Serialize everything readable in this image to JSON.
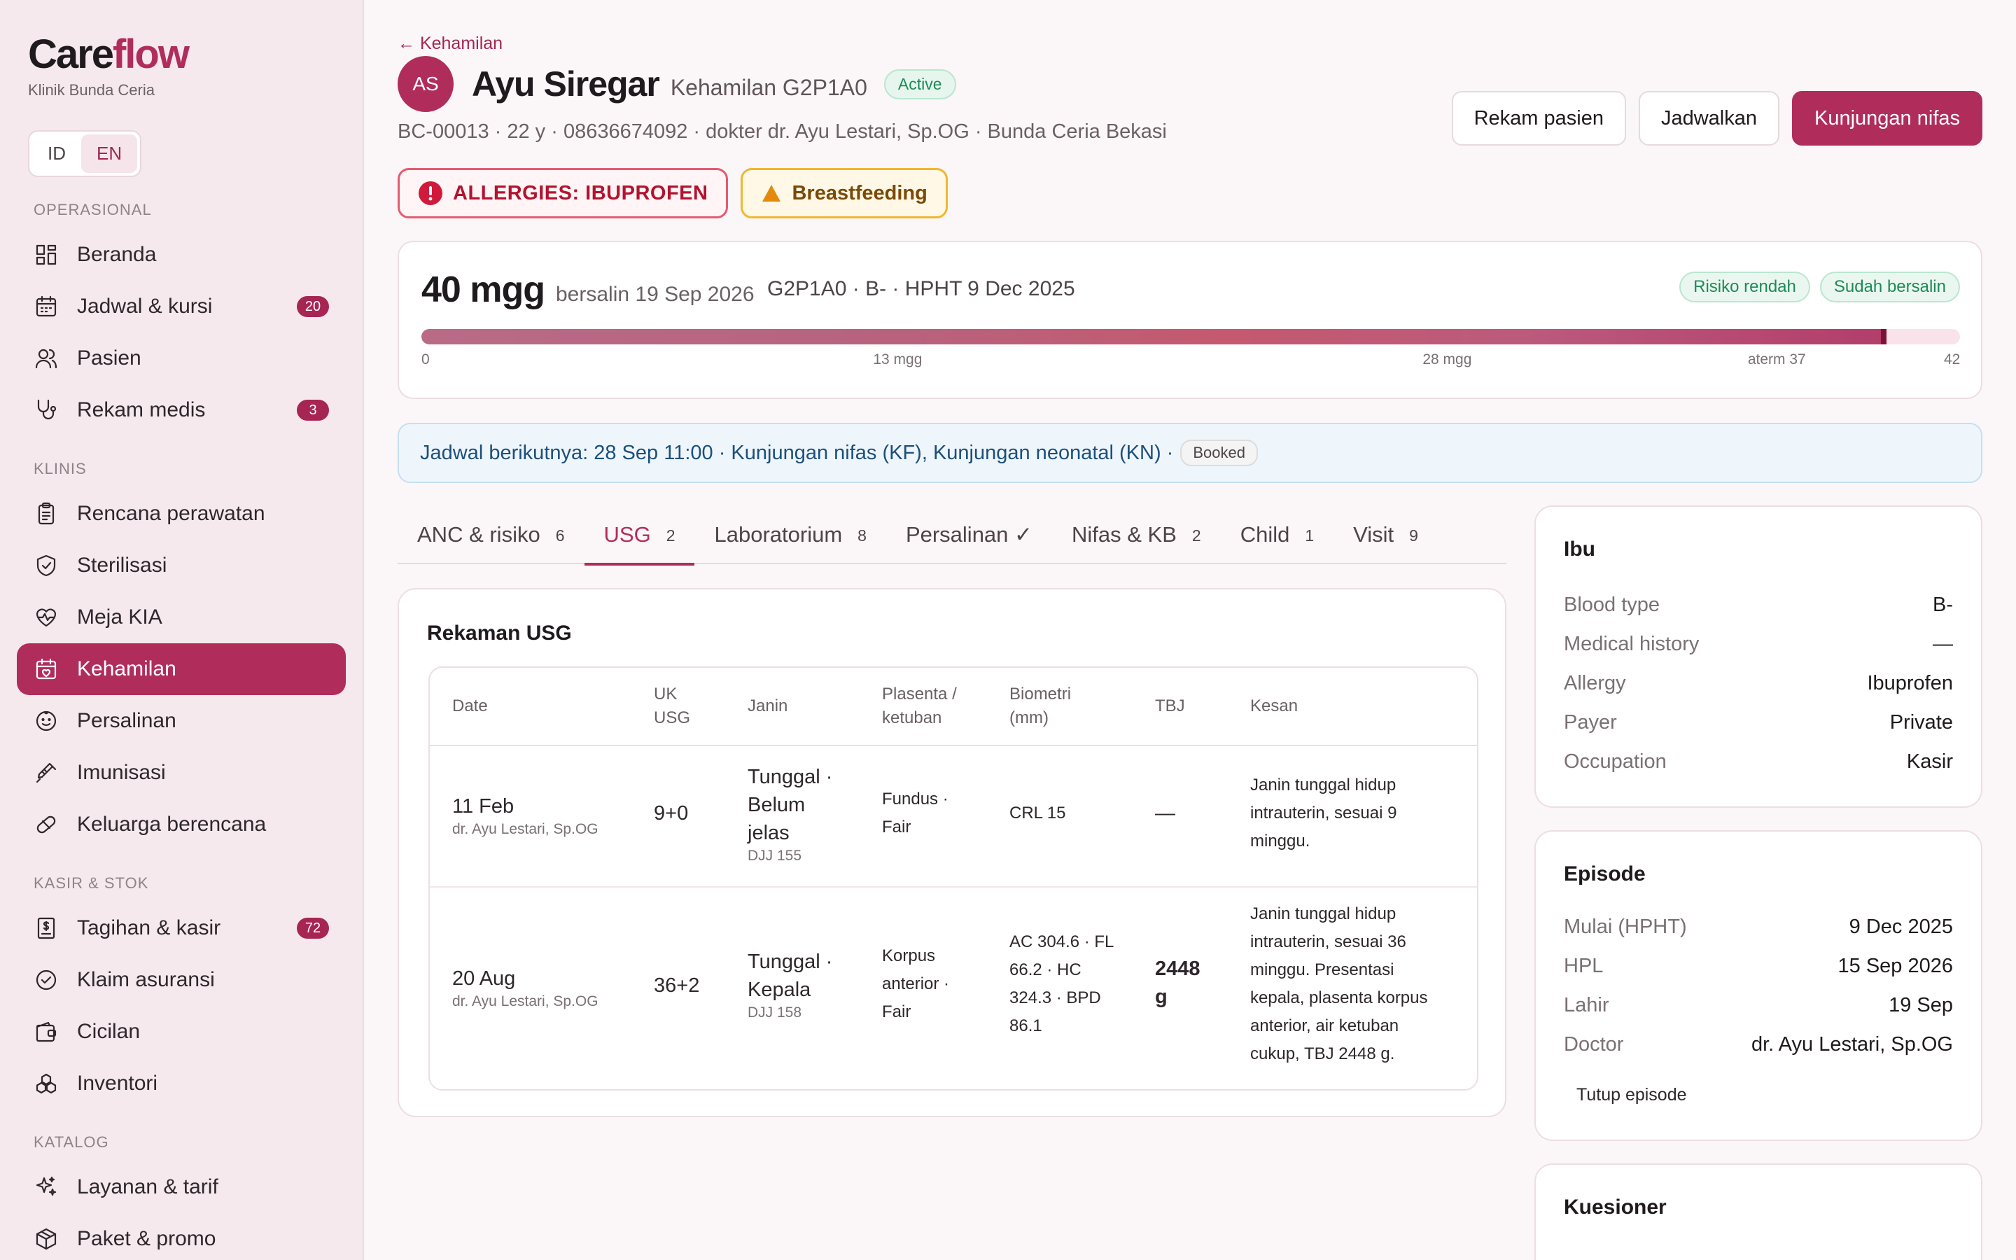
{
  "brand": {
    "part1": "Care",
    "part2": "flow",
    "clinic": "Klinik Bunda Ceria"
  },
  "lang": {
    "id": "ID",
    "en": "EN"
  },
  "sidebar": {
    "sections": [
      {
        "title": "OPERASIONAL",
        "items": [
          {
            "label": "Beranda",
            "icon": "grid-icon",
            "badge": ""
          },
          {
            "label": "Jadwal & kursi",
            "icon": "calendar-icon",
            "badge": "20"
          },
          {
            "label": "Pasien",
            "icon": "users-icon",
            "badge": ""
          },
          {
            "label": "Rekam medis",
            "icon": "stethoscope-icon",
            "badge": "3"
          }
        ]
      },
      {
        "title": "KLINIS",
        "items": [
          {
            "label": "Rencana perawatan",
            "icon": "clipboard-icon",
            "badge": ""
          },
          {
            "label": "Sterilisasi",
            "icon": "shield-icon",
            "badge": ""
          },
          {
            "label": "Meja KIA",
            "icon": "heart-pulse-icon",
            "badge": ""
          },
          {
            "label": "Kehamilan",
            "icon": "calendar-heart-icon",
            "badge": "",
            "active": true
          },
          {
            "label": "Persalinan",
            "icon": "baby-icon",
            "badge": ""
          },
          {
            "label": "Imunisasi",
            "icon": "syringe-icon",
            "badge": ""
          },
          {
            "label": "Keluarga berencana",
            "icon": "pill-icon",
            "badge": ""
          }
        ]
      },
      {
        "title": "KASIR & STOK",
        "items": [
          {
            "label": "Tagihan & kasir",
            "icon": "receipt-icon",
            "badge": "72"
          },
          {
            "label": "Klaim asuransi",
            "icon": "check-circle-icon",
            "badge": ""
          },
          {
            "label": "Cicilan",
            "icon": "wallet-icon",
            "badge": ""
          },
          {
            "label": "Inventori",
            "icon": "boxes-icon",
            "badge": ""
          }
        ]
      },
      {
        "title": "KATALOG",
        "items": [
          {
            "label": "Layanan & tarif",
            "icon": "sparkles-icon",
            "badge": ""
          },
          {
            "label": "Paket & promo",
            "icon": "package-icon",
            "badge": ""
          }
        ]
      }
    ]
  },
  "patient": {
    "back": "← Kehamilan",
    "initials": "AS",
    "name": "Ayu Siregar",
    "pregnancy": "Kehamilan G2P1A0",
    "status": "Active",
    "meta": "BC-00013 · 22 y · 08636674092 · dokter dr. Ayu Lestari, Sp.OG · Bunda Ceria Bekasi"
  },
  "actions": {
    "record": "Rekam pasien",
    "schedule": "Jadwalkan",
    "postnatal": "Kunjungan nifas"
  },
  "alerts": {
    "allergy": "ALLERGIES: IBUPROFEN",
    "note": "Breastfeeding"
  },
  "pregnancy_card": {
    "weeks": "40 mgg",
    "due": "bersalin 19 Sep 2026",
    "info": "G2P1A0 · B- · HPHT 9 Dec 2025",
    "tags": [
      "Risiko rendah",
      "Sudah bersalin"
    ],
    "progress_weeks": 40,
    "total_weeks": 42,
    "ticks": [
      {
        "label": "0",
        "week": 0
      },
      {
        "label": "13 mgg",
        "week": 13
      },
      {
        "label": "28 mgg",
        "week": 28
      },
      {
        "label": "aterm 37",
        "week": 37
      },
      {
        "label": "42",
        "week": 42
      }
    ]
  },
  "next_visit": {
    "text": "Jadwal berikutnya: 28 Sep 11:00 · Kunjungan nifas (KF), Kunjungan neonatal (KN) ·",
    "status": "Booked"
  },
  "tabs": [
    {
      "label": "ANC & risiko",
      "count": "6"
    },
    {
      "label": "USG",
      "count": "2",
      "active": true
    },
    {
      "label": "Laboratorium",
      "count": "8"
    },
    {
      "label": "Persalinan ✓",
      "count": ""
    },
    {
      "label": "Nifas & KB",
      "count": "2"
    },
    {
      "label": "Child",
      "count": "1"
    },
    {
      "label": "Visit",
      "count": "9"
    }
  ],
  "usg": {
    "title": "Rekaman USG",
    "headers": {
      "date": "Date",
      "uk1": "UK",
      "uk2": "USG",
      "janin": "Janin",
      "plas1": "Plasenta /",
      "plas2": "ketuban",
      "bio1": "Biometri",
      "bio2": "(mm)",
      "tbj": "TBJ",
      "kesan": "Kesan"
    },
    "rows": [
      {
        "date": "11 Feb",
        "doctor": "dr. Ayu Lestari, Sp.OG",
        "uk": "9+0",
        "janin": [
          "Tunggal ·",
          "Belum",
          "jelas"
        ],
        "djj": "DJJ 155",
        "plasenta": [
          "Fundus ·",
          "Fair"
        ],
        "biometri": [
          "CRL 15"
        ],
        "tbj": "—",
        "kesan": [
          "Janin tunggal hidup",
          "intrauterin, sesuai 9",
          "minggu."
        ]
      },
      {
        "date": "20 Aug",
        "doctor": "dr. Ayu Lestari, Sp.OG",
        "uk": "36+2",
        "janin": [
          "Tunggal ·",
          "Kepala"
        ],
        "djj": "DJJ 158",
        "plasenta": [
          "Korpus",
          "anterior ·",
          "Fair"
        ],
        "biometri": [
          "AC 304.6 · FL",
          "66.2 · HC",
          "324.3 · BPD",
          "86.1"
        ],
        "tbj": [
          "2448",
          "g"
        ],
        "kesan": [
          "Janin tunggal hidup",
          "intrauterin, sesuai 36",
          "minggu. Presentasi",
          "kepala, plasenta korpus",
          "anterior, air ketuban",
          "cukup, TBJ 2448 g."
        ]
      }
    ]
  },
  "mother": {
    "title": "Ibu",
    "rows": [
      {
        "k": "Blood type",
        "v": "B-"
      },
      {
        "k": "Medical history",
        "v": "—"
      },
      {
        "k": "Allergy",
        "v": "Ibuprofen"
      },
      {
        "k": "Payer",
        "v": "Private"
      },
      {
        "k": "Occupation",
        "v": "Kasir"
      }
    ]
  },
  "episode": {
    "title": "Episode",
    "rows": [
      {
        "k": "Mulai (HPHT)",
        "v": "9 Dec 2025"
      },
      {
        "k": "HPL",
        "v": "15 Sep 2026"
      },
      {
        "k": "Lahir",
        "v": "19 Sep"
      },
      {
        "k": "Doctor",
        "v": "dr. Ayu Lestari, Sp.OG"
      }
    ],
    "close": "Tutup episode"
  },
  "questionnaire": {
    "title": "Kuesioner"
  }
}
